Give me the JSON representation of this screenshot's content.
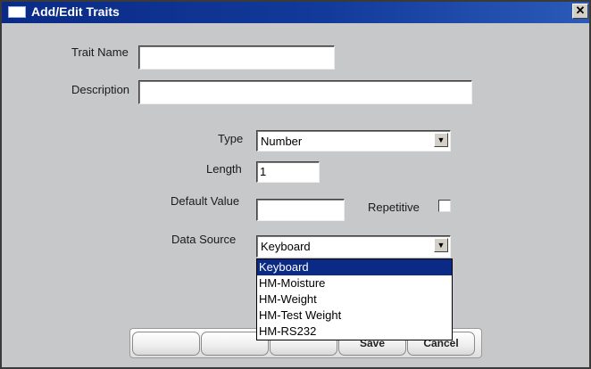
{
  "window": {
    "title": "Add/Edit Traits",
    "close_glyph": "✕"
  },
  "form": {
    "trait_name_label": "Trait Name",
    "trait_name_value": "",
    "description_label": "Description",
    "description_value": "",
    "type_label": "Type",
    "type_value": "Number",
    "length_label": "Length",
    "length_value": "1",
    "default_value_label": "Default Value",
    "default_value_value": "",
    "repetitive_label": "Repetitive",
    "repetitive_checked": false,
    "data_source_label": "Data Source",
    "data_source_value": "Keyboard",
    "data_source_options": [
      "Keyboard",
      "HM-Moisture",
      "HM-Weight",
      "HM-Test Weight",
      "HM-RS232"
    ]
  },
  "buttons": {
    "blank1": "",
    "blank2": "",
    "blank3": "",
    "save": "Save",
    "cancel": "Cancel"
  },
  "icons": {
    "window_icon": "window-icon",
    "close": "close-icon",
    "dropdown_arrow": "chevron-down-icon"
  }
}
